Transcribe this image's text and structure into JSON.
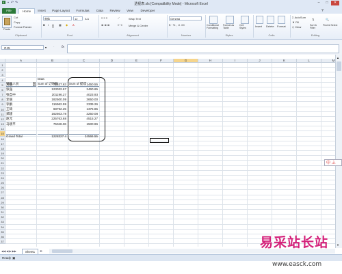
{
  "window": {
    "title": "透视表.xls [Compatibility Mode] - Microsoft Excel"
  },
  "ribbon": {
    "tabs": [
      "File",
      "Home",
      "Insert",
      "Page Layout",
      "Formulas",
      "Data",
      "Review",
      "View",
      "Developer"
    ],
    "active_tab": "Home",
    "clipboard": {
      "paste": "Paste",
      "cut": "Cut",
      "copy": "Copy",
      "format_painter": "Format Painter",
      "label": "Clipboard"
    },
    "font": {
      "name": "宋体",
      "size": "12",
      "label": "Font"
    },
    "alignment": {
      "wrap_text": "Wrap Text",
      "merge_center": "Merge & Center",
      "label": "Alignment"
    },
    "number": {
      "format": "General",
      "label": "Number"
    },
    "styles": {
      "conditional": "Conditional Formatting",
      "format_table": "Format as Table",
      "cell_styles": "Cell Styles",
      "label": "Styles"
    },
    "cells": {
      "insert": "Insert",
      "delete": "Delete",
      "format": "Format",
      "label": "Cells"
    },
    "editing": {
      "autosum": "AutoSum",
      "fill": "Fill",
      "clear": "Clear",
      "sort_filter": "Sort & Filter",
      "find_select": "Find & Select",
      "label": "Editing"
    }
  },
  "formula_bar": {
    "name_box": "G15",
    "fx": "fx",
    "content": ""
  },
  "grid": {
    "columns": [
      "A",
      "B",
      "C",
      "D",
      "E",
      "F",
      "G",
      "H",
      "I",
      "J",
      "K",
      "L",
      "M"
    ],
    "selected_column": "G",
    "selected_row": 15,
    "pivot": {
      "data_header": "Data",
      "row_field": "销售人员",
      "col_b_header": "Sum of 订购额",
      "col_c_header": "Sum of 提成",
      "rows": [
        {
          "name": "刘丽",
          "b": "72527.63",
          "c": "1450.55"
        },
        {
          "name": "张强",
          "b": "123032.67",
          "c": "2460.65"
        },
        {
          "name": "张自中",
          "b": "201196.27",
          "c": "4023.93"
        },
        {
          "name": "李丽",
          "b": "182500.09",
          "c": "3650.00"
        },
        {
          "name": "李鹏",
          "b": "116962.99",
          "c": "2339.26"
        },
        {
          "name": "王琦",
          "b": "68792.25",
          "c": "1375.85"
        },
        {
          "name": "郑建",
          "b": "162503.78",
          "c": "3250.08"
        },
        {
          "name": "赵元",
          "b": "225763.68",
          "c": "4515.27"
        },
        {
          "name": "马晓平",
          "b": "75048.06",
          "c": "1500.96"
        }
      ],
      "total": {
        "name": "Grand Total",
        "b": "1228327.4",
        "c": "24566.55"
      }
    }
  },
  "sheets": {
    "tabs": [
      "Sheet1"
    ]
  },
  "status": {
    "ready": "Ready"
  },
  "watermark": {
    "big": "易采站长站",
    "url": "www.easck.com"
  },
  "ime": {
    "label": "中 ふ"
  }
}
